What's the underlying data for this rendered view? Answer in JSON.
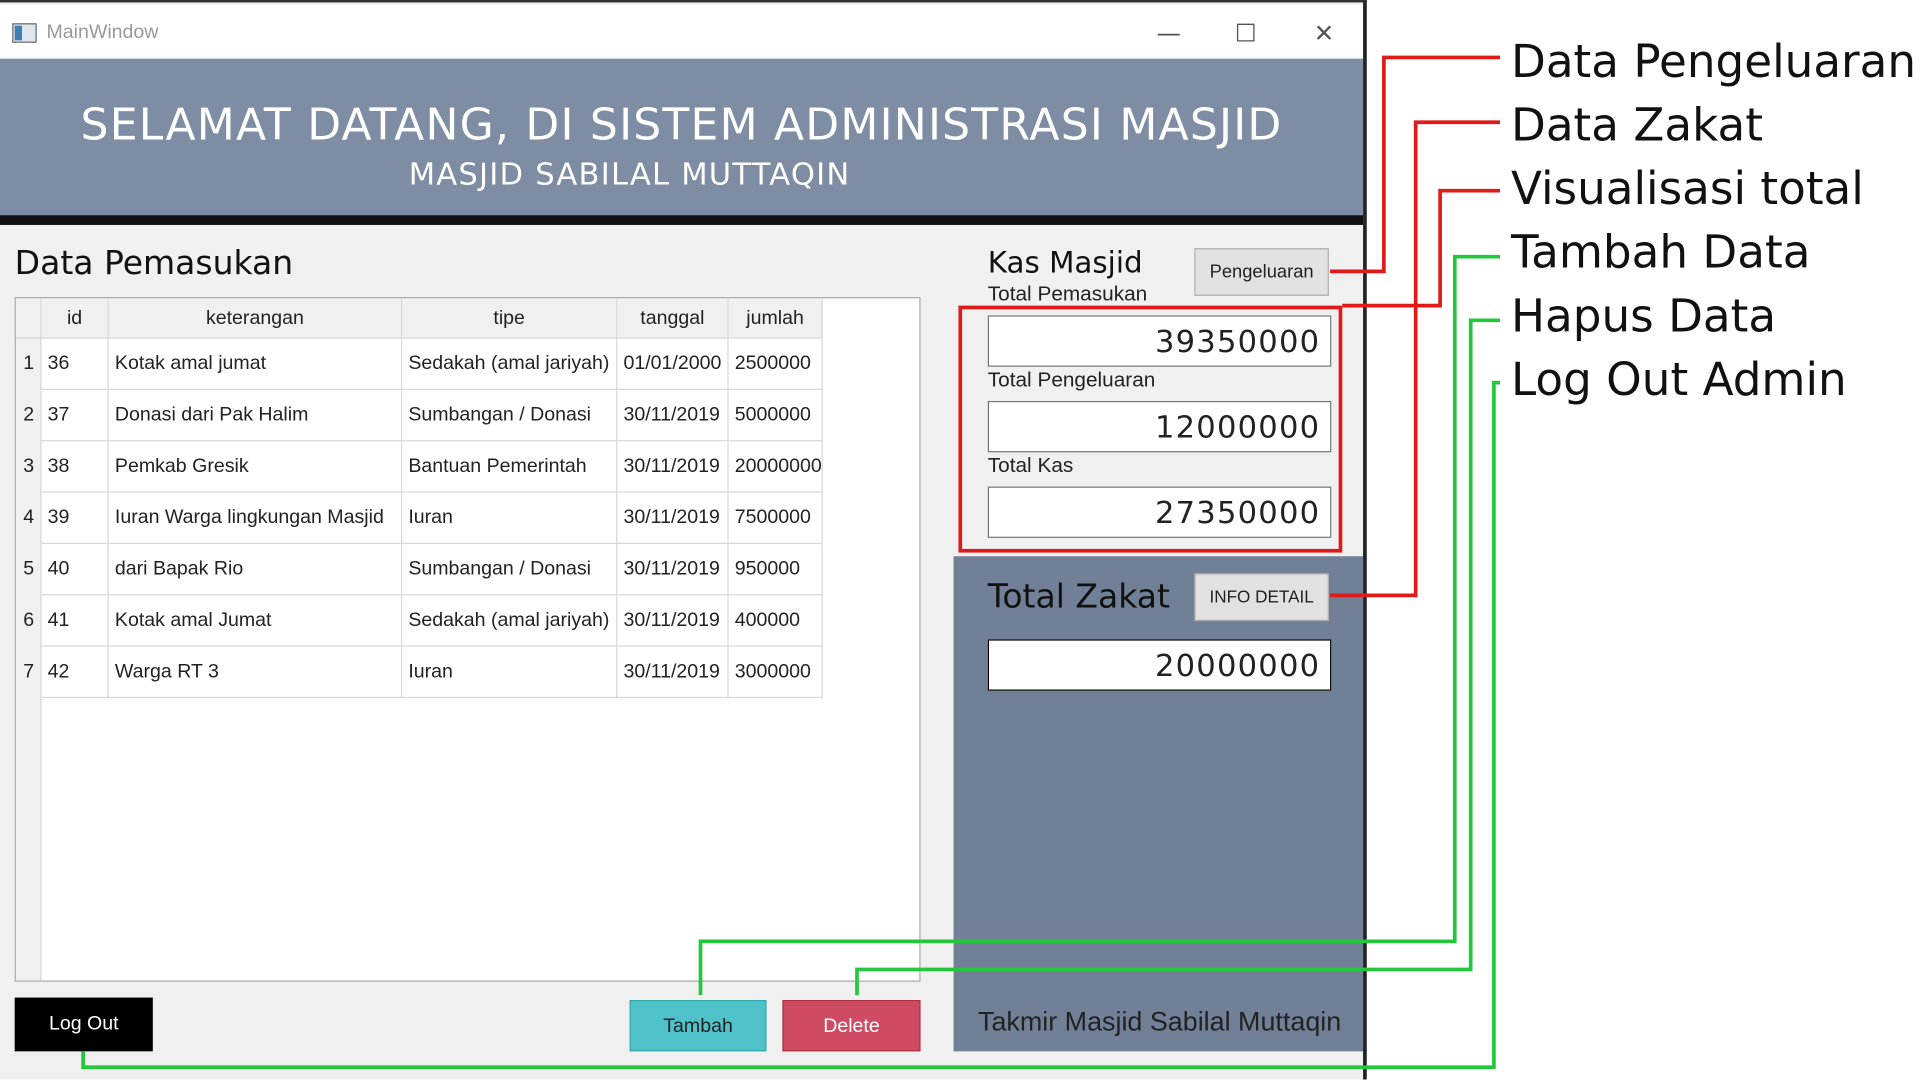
{
  "window": {
    "title": "MainWindow",
    "minimize": "—",
    "maximize": "☐",
    "close": "✕"
  },
  "banner": {
    "title": "SELAMAT DATANG, DI SISTEM ADMINISTRASI MASJID",
    "subtitle": "MASJID SABILAL MUTTAQIN"
  },
  "pemasukan": {
    "title": "Data Pemasukan",
    "columns": [
      "id",
      "keterangan",
      "tipe",
      "tanggal",
      "jumlah"
    ],
    "rows": [
      {
        "num": "1",
        "id": "36",
        "keterangan": "Kotak amal jumat",
        "tipe": "Sedakah (amal jariyah)",
        "tanggal": "01/01/2000",
        "jumlah": "2500000"
      },
      {
        "num": "2",
        "id": "37",
        "keterangan": "Donasi dari Pak Halim",
        "tipe": "Sumbangan / Donasi",
        "tanggal": "30/11/2019",
        "jumlah": "5000000"
      },
      {
        "num": "3",
        "id": "38",
        "keterangan": "Pemkab Gresik",
        "tipe": "Bantuan Pemerintah",
        "tanggal": "30/11/2019",
        "jumlah": "20000000"
      },
      {
        "num": "4",
        "id": "39",
        "keterangan": "Iuran Warga lingkungan Masjid",
        "tipe": "Iuran",
        "tanggal": "30/11/2019",
        "jumlah": "7500000"
      },
      {
        "num": "5",
        "id": "40",
        "keterangan": "dari Bapak Rio",
        "tipe": "Sumbangan / Donasi",
        "tanggal": "30/11/2019",
        "jumlah": "950000"
      },
      {
        "num": "6",
        "id": "41",
        "keterangan": "Kotak amal Jumat",
        "tipe": "Sedakah (amal jariyah)",
        "tanggal": "30/11/2019",
        "jumlah": "400000"
      },
      {
        "num": "7",
        "id": "42",
        "keterangan": "Warga RT 3",
        "tipe": "Iuran",
        "tanggal": "30/11/2019",
        "jumlah": "3000000"
      }
    ]
  },
  "buttons": {
    "logout": "Log Out",
    "tambah": "Tambah",
    "delete": "Delete",
    "pengeluaran": "Pengeluaran",
    "info_detail": "INFO DETAIL"
  },
  "kas": {
    "title": "Kas Masjid",
    "total_pemasukan_label": "Total Pemasukan",
    "total_pemasukan": "39350000",
    "total_pengeluaran_label": "Total Pengeluaran",
    "total_pengeluaran": "12000000",
    "total_kas_label": "Total Kas",
    "total_kas": "27350000"
  },
  "zakat": {
    "title": "Total Zakat",
    "value": "20000000"
  },
  "footer": "Takmir Masjid Sabilal Muttaqin",
  "annotations": [
    "Data Pengeluaran",
    "Data Zakat",
    "Visualisasi total",
    "Tambah Data",
    "Hapus Data",
    "Log Out Admin"
  ],
  "colors": {
    "banner": "#7e8da3",
    "zakat_panel": "#718097",
    "tambah": "#4fc1c9",
    "delete": "#cf4b63",
    "red_callout": "#e01919",
    "green_callout": "#22c73a"
  }
}
